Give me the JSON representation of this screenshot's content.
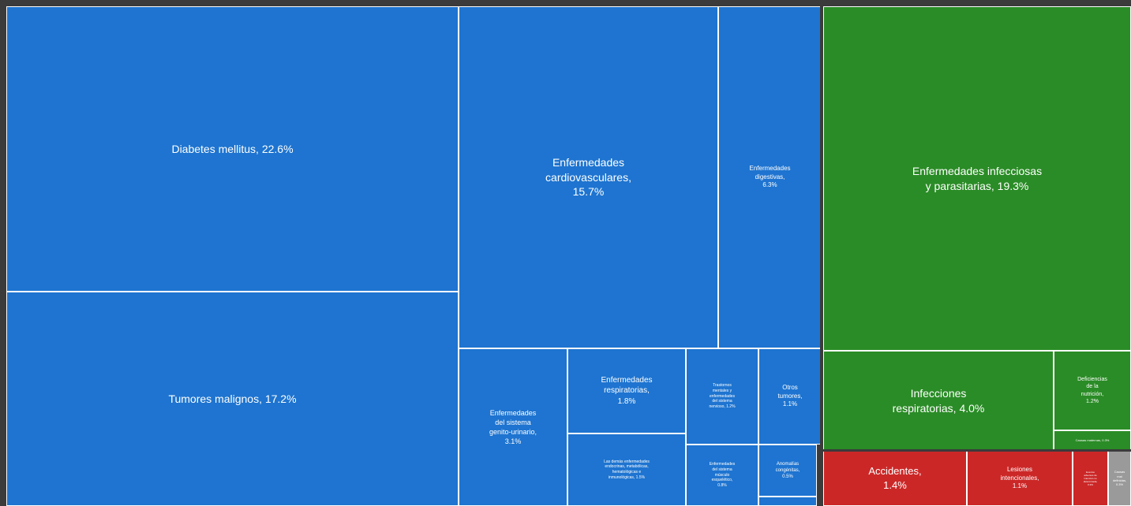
{
  "chart_data": {
    "type": "treemap",
    "colors": {
      "blue": "#1e74d0",
      "green": "#2a8c26",
      "red": "#cc2727",
      "gray": "#9a9a9a",
      "border": "#ffffff",
      "frame": "#3b3b3b"
    },
    "groups": [
      {
        "color": "blue",
        "items": [
          {
            "label": "Diabetes mellitus, 22.6%",
            "value": 22.6
          },
          {
            "label": "Tumores malignos, 17.2%",
            "value": 17.2
          },
          {
            "label": "Enfermedades\ncardiovasculares,\n15.7%",
            "value": 15.7
          },
          {
            "label": "Enfermedades\ndigestivas,\n6.3%",
            "value": 6.3
          },
          {
            "label": "Enfermedades\ndel sistema\ngenito-urinario,\n3.1%",
            "value": 3.1
          },
          {
            "label": "Enfermedades\nrespiratorias,\n1.8%",
            "value": 1.8
          },
          {
            "label": "Las demás enfermedades\nendocrinas, metabólicas,\nhematológicas e\ninmunológicas, 1.5%",
            "value": 1.5
          },
          {
            "label": "Trastornos\nmentales y\nenfermedades\ndel sistema\nnervioso, 1.2%",
            "value": 1.2
          },
          {
            "label": "Otros\ntumores,\n1.1%",
            "value": 1.1
          },
          {
            "label": "Enfermedades\ndel sistema\nmúsculo\nesquelético,\n0.8%",
            "value": 0.8
          },
          {
            "label": "Anomalías\ncongénitas,\n0.5%",
            "value": 0.5
          },
          {
            "label": "",
            "value": 0.1
          }
        ]
      },
      {
        "color": "green",
        "items": [
          {
            "label": "Enfermedades infecciosas\ny parasitarias, 19.3%",
            "value": 19.3
          },
          {
            "label": "Infecciones\nrespiratorias, 4.0%",
            "value": 4.0
          },
          {
            "label": "Deficiencias\nde la\nnutrición,\n1.2%",
            "value": 1.2
          },
          {
            "label": "Causas maternas, 0.3%",
            "value": 0.3
          }
        ]
      },
      {
        "color": "red",
        "items": [
          {
            "label": "Accidentes,\n1.4%",
            "value": 1.4
          },
          {
            "label": "Lesiones\nintencionales,\n1.1%",
            "value": 1.1
          },
          {
            "label": "Eventos\nadversos de\nintención no\ndeterminada,\n0.3%",
            "value": 0.3
          }
        ]
      },
      {
        "color": "gray",
        "items": [
          {
            "label": "Causas\nmal\ndefinidas,\n0.3%",
            "value": 0.3
          }
        ]
      }
    ]
  }
}
